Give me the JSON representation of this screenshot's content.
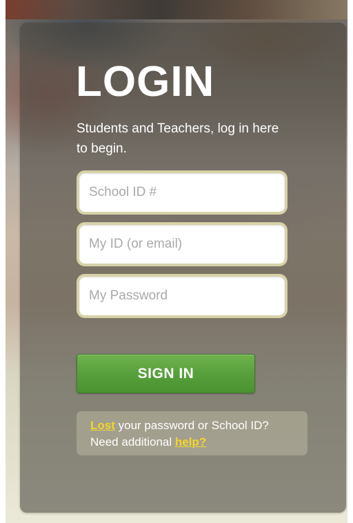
{
  "login": {
    "title": "LOGIN",
    "subtitle": "Students and Teachers, log in here to begin."
  },
  "fields": {
    "school_id": {
      "placeholder": "School ID #",
      "value": ""
    },
    "user_id": {
      "placeholder": "My ID (or email)",
      "value": ""
    },
    "password": {
      "placeholder": "My Password",
      "value": ""
    }
  },
  "sign_in": {
    "label": "SIGN IN",
    "color": "#5ba23f"
  },
  "help": {
    "lost_link": "Lost",
    "lost_text": " your password or School ID?",
    "need_text": "Need additional ",
    "help_link": "help?",
    "link_color": "#f3d52c"
  }
}
